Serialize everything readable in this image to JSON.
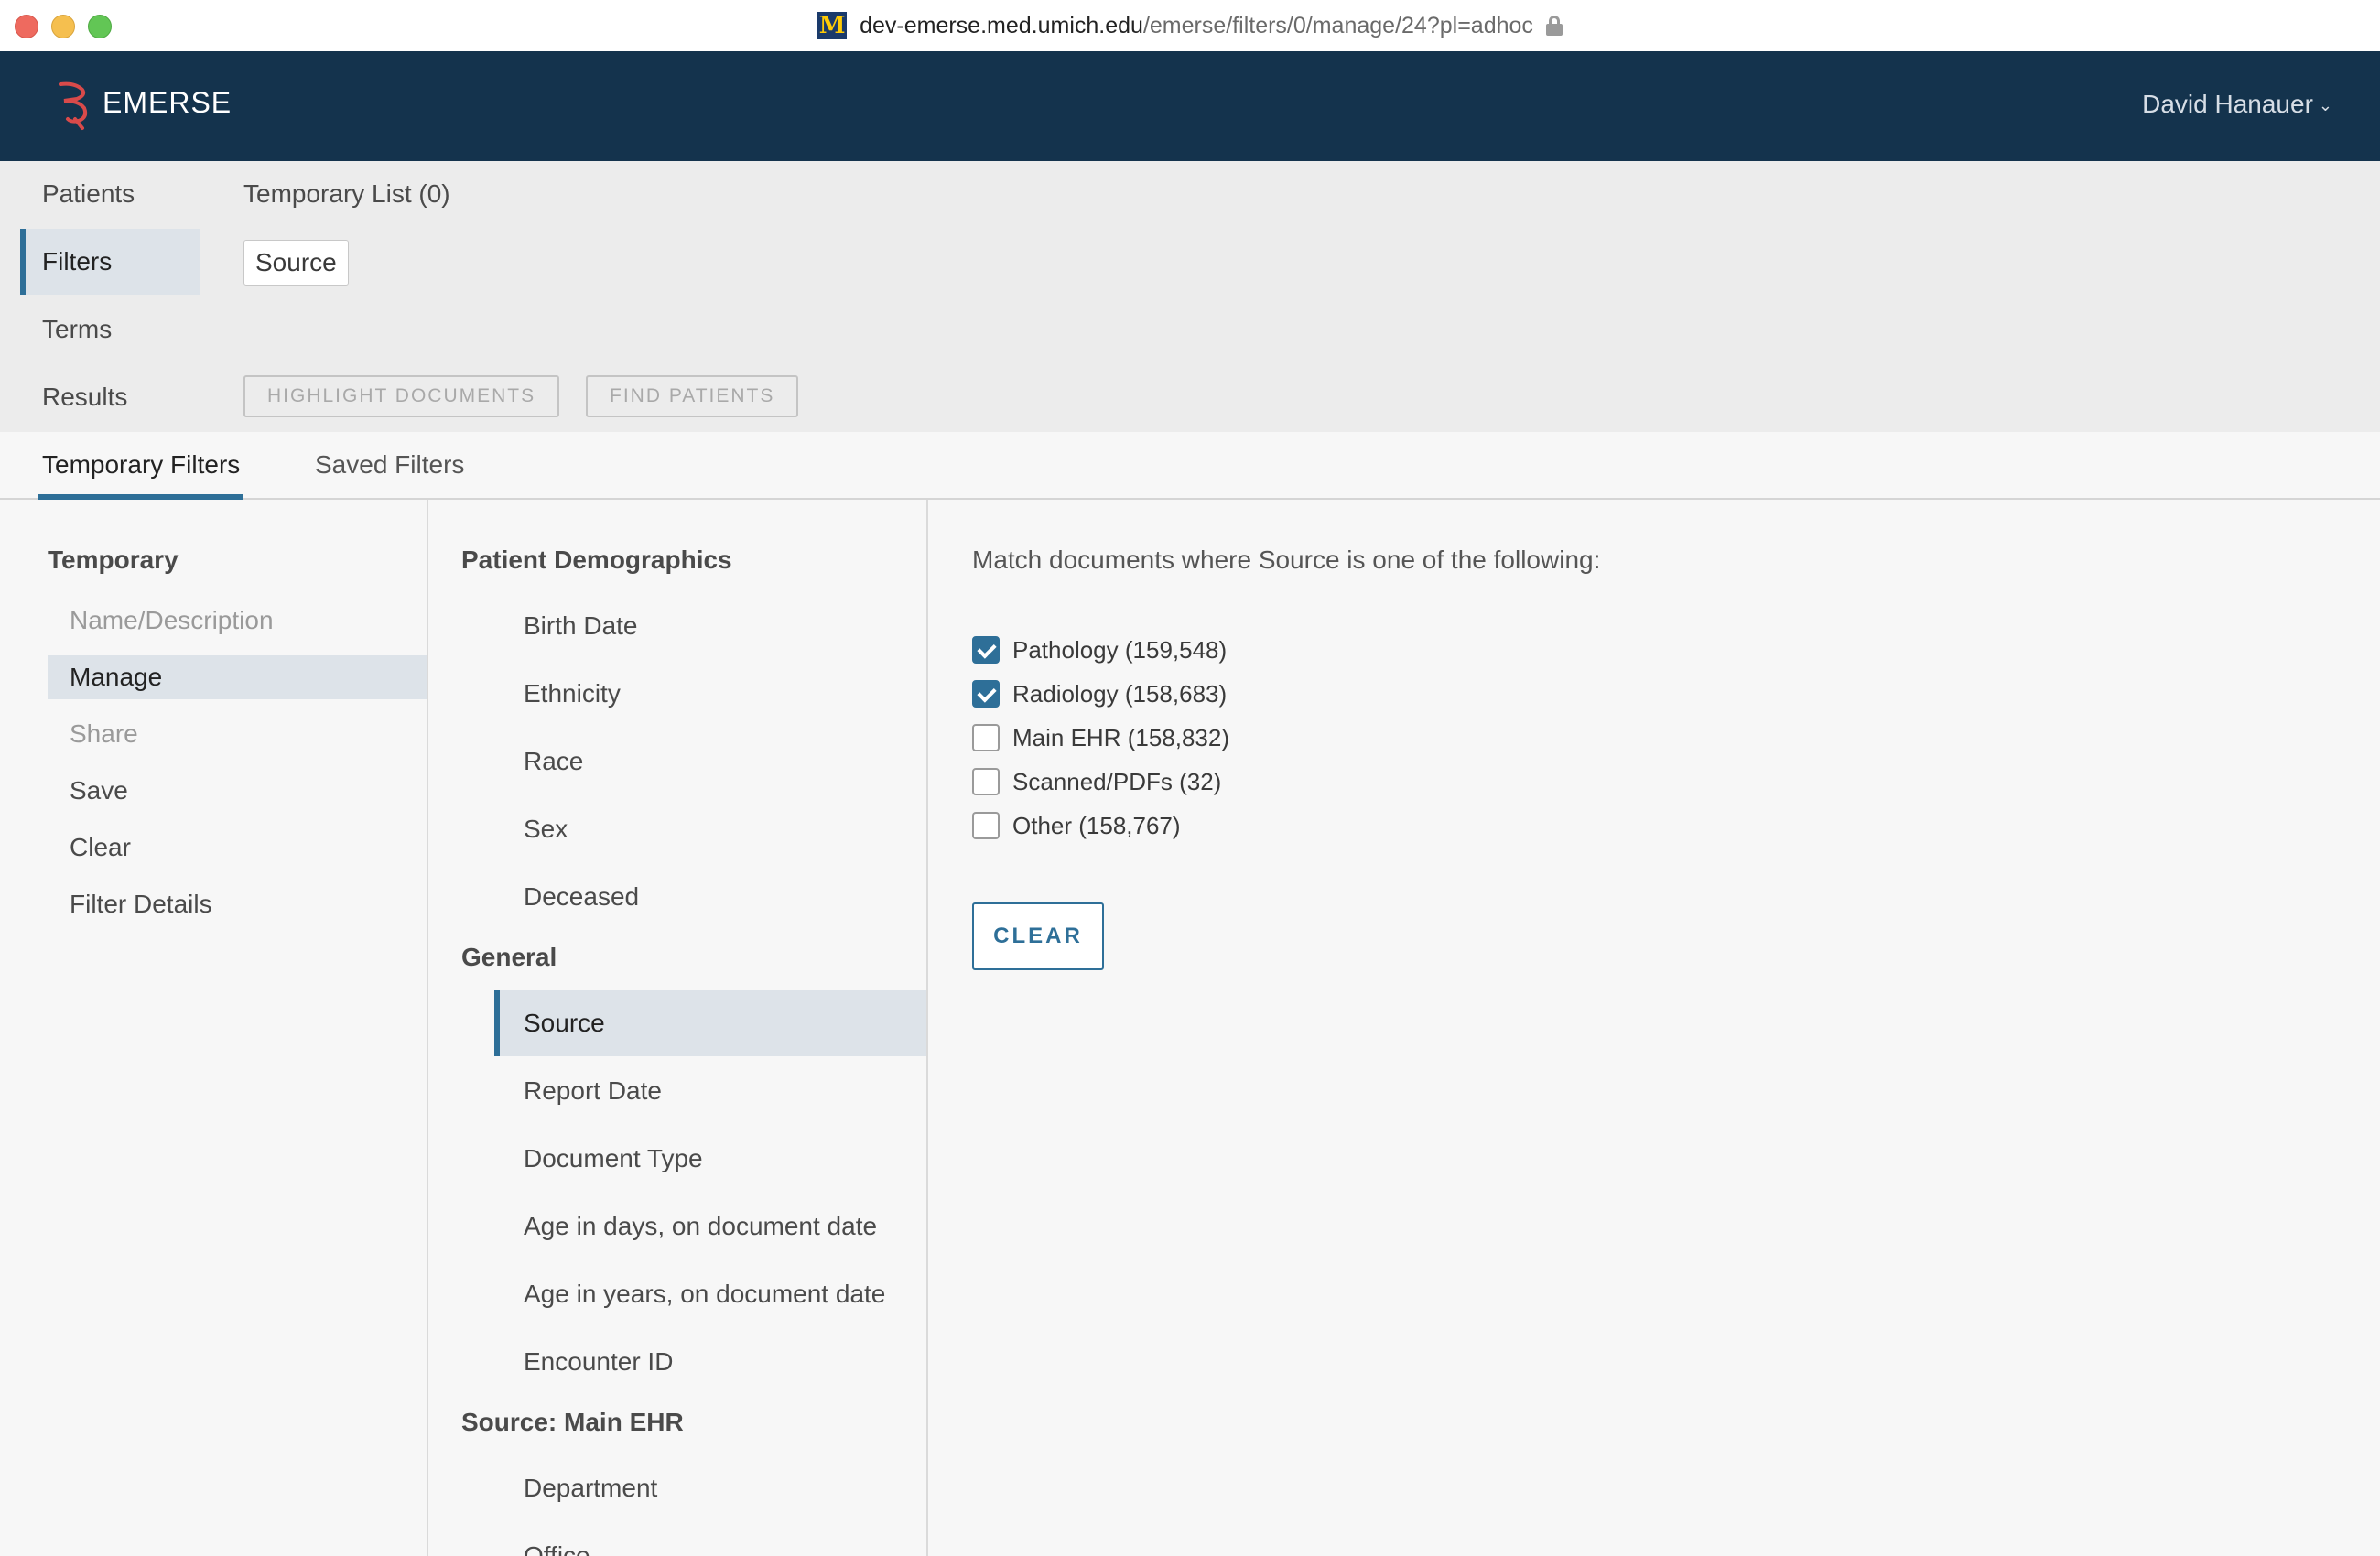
{
  "browser": {
    "url_host": "dev-emerse.med.umich.edu",
    "url_path": "/emerse/filters/0/manage/24?pl=adhoc",
    "favicon_letter": "M"
  },
  "header": {
    "brand": "EMERSE",
    "user_name": "David Hanauer",
    "user_chevron": "⌄"
  },
  "nav": {
    "items": [
      "Patients",
      "Filters",
      "Terms",
      "Results"
    ],
    "active": "Filters",
    "temporary_list": "Temporary List (0)",
    "chip": "Source",
    "highlight_button": "HIGHLIGHT DOCUMENTS",
    "find_patients_button": "FIND PATIENTS"
  },
  "tabs": {
    "temporary": "Temporary Filters",
    "saved": "Saved Filters"
  },
  "left": {
    "title": "Temporary",
    "items": [
      "Name/Description",
      "Manage",
      "Share",
      "Save",
      "Clear",
      "Filter Details"
    ],
    "active": "Manage"
  },
  "middle": {
    "sections": [
      {
        "title": "Patient Demographics",
        "items": [
          "Birth Date",
          "Ethnicity",
          "Race",
          "Sex",
          "Deceased"
        ]
      },
      {
        "title": "General",
        "items": [
          "Source",
          "Report Date",
          "Document Type",
          "Age in days, on document date",
          "Age in years, on document date",
          "Encounter ID"
        ]
      },
      {
        "title": "Source: Main EHR",
        "items": [
          "Department",
          "Office"
        ]
      }
    ],
    "active": "Source"
  },
  "right": {
    "prompt": "Match documents where Source is one of the following:",
    "options": [
      {
        "label": "Pathology (159,548)",
        "checked": true
      },
      {
        "label": "Radiology (158,683)",
        "checked": true
      },
      {
        "label": "Main EHR (158,832)",
        "checked": false
      },
      {
        "label": "Scanned/PDFs (32)",
        "checked": false
      },
      {
        "label": "Other (158,767)",
        "checked": false
      }
    ],
    "clear_button": "CLEAR"
  },
  "colors": {
    "header_bg": "#14334d",
    "accent": "#2e6f98",
    "selected_bg": "#dde3e9"
  }
}
